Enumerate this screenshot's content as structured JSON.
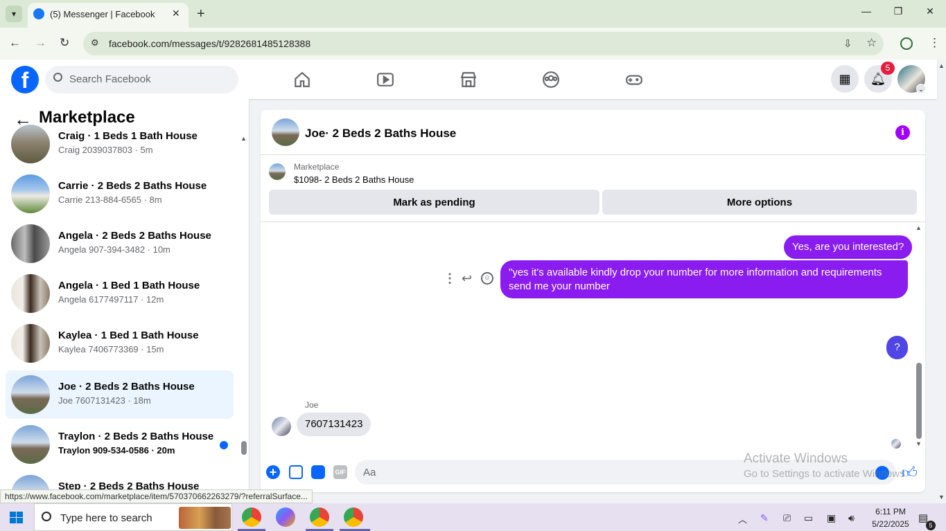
{
  "browser": {
    "tab_title": "(5) Messenger | Facebook",
    "url": "facebook.com/messages/t/9282681485128388",
    "status_url": "https://www.facebook.com/marketplace/item/570370662263279/?referralSurface..."
  },
  "fb_header": {
    "search_placeholder": "Search Facebook",
    "logo_letter": "f",
    "notification_count": "5"
  },
  "left_panel": {
    "title": "Marketplace",
    "conversations": [
      {
        "title": "Craig · 1 Beds 1 Bath House",
        "sub": "Craig 2039037803 · 5m",
        "active": false,
        "unread": false
      },
      {
        "title": "Carrie · 2 Beds 2 Baths House",
        "sub": "Carrie 213-884-6565 · 8m",
        "active": false,
        "unread": false
      },
      {
        "title": "Angela · 2 Beds 2 Baths House",
        "sub": "Angela 907-394-3482 · 10m",
        "active": false,
        "unread": false
      },
      {
        "title": "Angela · 1 Bed 1 Bath House",
        "sub": "Angela 6177497117 · 12m",
        "active": false,
        "unread": false
      },
      {
        "title": "Kaylea · 1 Bed 1 Bath House",
        "sub": "Kaylea 7406773369 · 15m",
        "active": false,
        "unread": false
      },
      {
        "title": "Joe · 2 Beds 2 Baths House",
        "sub": "Joe 7607131423 · 18m",
        "active": true,
        "unread": false
      },
      {
        "title": "Traylon · 2 Beds 2 Baths House",
        "sub": "Traylon 909-534-0586 · 20m",
        "active": false,
        "unread": true
      },
      {
        "title": "Step · 2 Beds 2 Baths House",
        "sub": "",
        "active": false,
        "unread": false
      }
    ]
  },
  "chat": {
    "title": "Joe· 2 Beds 2 Baths House",
    "listing_label": "Marketplace",
    "listing_price": "$1098- 2 Beds 2 Baths House",
    "mark_pending": "Mark as pending",
    "more_options": "More options",
    "messages": {
      "out1": "Yes, are you interested?",
      "out2": "\"yes it's available kindly drop your number for more information and requirements send me your number",
      "help": "?",
      "sender_name": "Joe",
      "in1": "7607131423"
    },
    "composer_placeholder": "Aa",
    "gif_label": "GIF"
  },
  "watermark": {
    "line1": "Activate Windows",
    "line2": "Go to Settings to activate Windows."
  },
  "taskbar": {
    "search_placeholder": "Type here to search",
    "time": "6:11 PM",
    "date": "5/22/2025",
    "notification_count": "5"
  },
  "colors": {
    "facebook_blue": "#0866ff",
    "message_purple": "#8a1cf0",
    "info_purple": "#a100ff"
  }
}
